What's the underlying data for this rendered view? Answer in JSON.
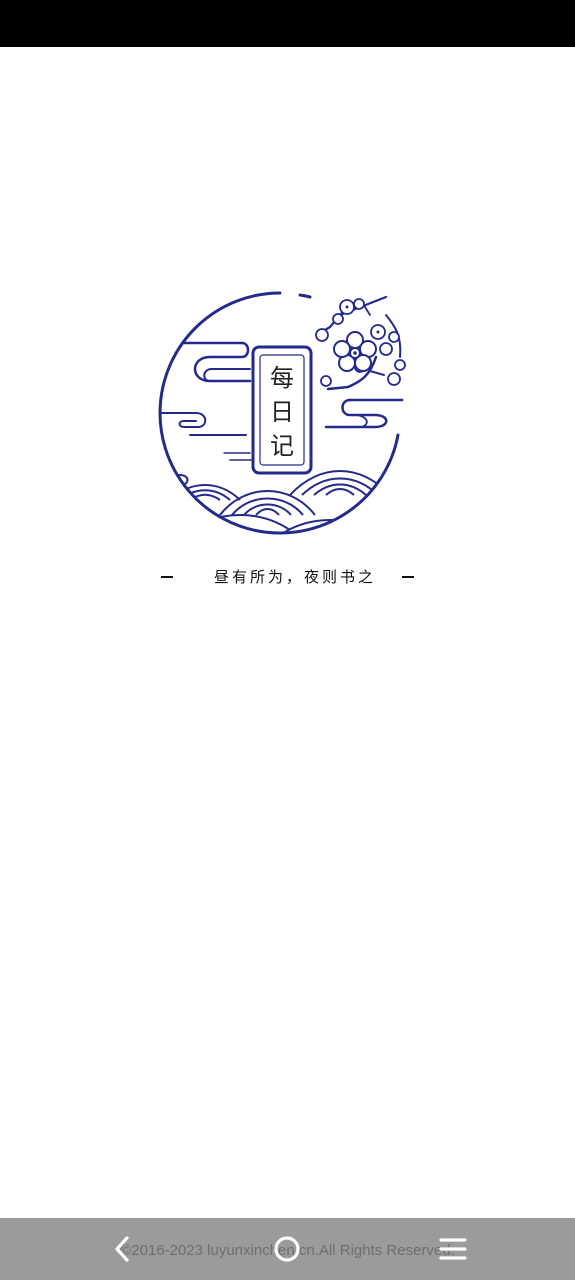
{
  "app": {
    "logo_text": "每日记",
    "slogan": "昼有所为，夜则书之",
    "accent_color": "#242a8c"
  },
  "footer": {
    "copyright": "©2016-2023 luyunxinchen.cn.All Rights Reserved."
  },
  "nav": {
    "back_icon": "chevron-left-icon",
    "home_icon": "circle-home-icon",
    "menu_icon": "hamburger-menu-icon"
  }
}
